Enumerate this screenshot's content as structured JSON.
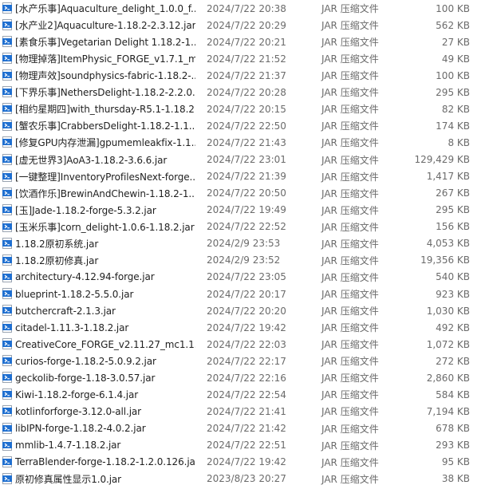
{
  "colors": {
    "icon_blue": "#1f6fd0",
    "text_primary": "#1f1f1f",
    "text_secondary": "#6b6b6b"
  },
  "files": [
    {
      "name": "[水产乐事]Aquaculture_delight_1.0.0_f...",
      "date": "2024/7/22 20:38",
      "type": "JAR 压缩文件",
      "size": "100 KB",
      "icon": "jar-file-icon"
    },
    {
      "name": "[水产业2]Aquaculture-1.18.2-2.3.12.jar",
      "date": "2024/7/22 20:29",
      "type": "JAR 压缩文件",
      "size": "562 KB",
      "icon": "jar-file-icon"
    },
    {
      "name": "[素食乐事]Vegetarian Delight 1.18.2-1...",
      "date": "2024/7/22 20:21",
      "type": "JAR 压缩文件",
      "size": "27 KB",
      "icon": "jar-file-icon"
    },
    {
      "name": "[物理掉落]ItemPhysic_FORGE_v1.7.1_m...",
      "date": "2024/7/22 21:52",
      "type": "JAR 压缩文件",
      "size": "49 KB",
      "icon": "jar-file-icon"
    },
    {
      "name": "[物理声效]soundphysics-fabric-1.18.2-...",
      "date": "2024/7/22 21:37",
      "type": "JAR 压缩文件",
      "size": "100 KB",
      "icon": "jar-file-icon"
    },
    {
      "name": "[下界乐事]NethersDelight-1.18.2-2.2.0....",
      "date": "2024/7/22 20:28",
      "type": "JAR 压缩文件",
      "size": "295 KB",
      "icon": "jar-file-icon"
    },
    {
      "name": "[相约星期四]with_thursday-R5.1-1.18.2...",
      "date": "2024/7/22 20:15",
      "type": "JAR 压缩文件",
      "size": "82 KB",
      "icon": "jar-file-icon"
    },
    {
      "name": "[蟹农乐事]CrabbersDelight-1.18.2-1.1....",
      "date": "2024/7/22 22:50",
      "type": "JAR 压缩文件",
      "size": "174 KB",
      "icon": "jar-file-icon"
    },
    {
      "name": "[修复GPU内存泄漏]gpumemleakfix-1.1...",
      "date": "2024/7/22 21:43",
      "type": "JAR 压缩文件",
      "size": "8 KB",
      "icon": "jar-file-icon"
    },
    {
      "name": "[虚无世界3]AoA3-1.18.2-3.6.6.jar",
      "date": "2024/7/22 23:01",
      "type": "JAR 压缩文件",
      "size": "129,429 KB",
      "icon": "jar-file-icon"
    },
    {
      "name": "[一键整理]InventoryProfilesNext-forge...",
      "date": "2024/7/22 21:39",
      "type": "JAR 压缩文件",
      "size": "1,417 KB",
      "icon": "jar-file-icon"
    },
    {
      "name": "[饮酒作乐]BrewinAndChewin-1.18.2-1....",
      "date": "2024/7/22 20:50",
      "type": "JAR 压缩文件",
      "size": "267 KB",
      "icon": "jar-file-icon"
    },
    {
      "name": "[玉]Jade-1.18.2-forge-5.3.2.jar",
      "date": "2024/7/22 19:49",
      "type": "JAR 压缩文件",
      "size": "295 KB",
      "icon": "jar-file-icon"
    },
    {
      "name": "[玉米乐事]corn_delight-1.0.6-1.18.2.jar",
      "date": "2024/7/22 22:52",
      "type": "JAR 压缩文件",
      "size": "156 KB",
      "icon": "jar-file-icon"
    },
    {
      "name": "1.18.2原初系统.jar",
      "date": "2024/2/9 23:53",
      "type": "JAR 压缩文件",
      "size": "4,053 KB",
      "icon": "jar-file-icon"
    },
    {
      "name": "1.18.2原初修真.jar",
      "date": "2024/2/9 23:52",
      "type": "JAR 压缩文件",
      "size": "19,356 KB",
      "icon": "jar-file-icon"
    },
    {
      "name": "architectury-4.12.94-forge.jar",
      "date": "2024/7/22 23:05",
      "type": "JAR 压缩文件",
      "size": "540 KB",
      "icon": "jar-file-icon"
    },
    {
      "name": "blueprint-1.18.2-5.5.0.jar",
      "date": "2024/7/22 20:17",
      "type": "JAR 压缩文件",
      "size": "923 KB",
      "icon": "jar-file-icon"
    },
    {
      "name": "butchercraft-2.1.3.jar",
      "date": "2024/7/22 20:20",
      "type": "JAR 压缩文件",
      "size": "1,030 KB",
      "icon": "jar-file-icon"
    },
    {
      "name": "citadel-1.11.3-1.18.2.jar",
      "date": "2024/7/22 19:42",
      "type": "JAR 压缩文件",
      "size": "492 KB",
      "icon": "jar-file-icon"
    },
    {
      "name": "CreativeCore_FORGE_v2.11.27_mc1.1...",
      "date": "2024/7/22 22:03",
      "type": "JAR 压缩文件",
      "size": "1,072 KB",
      "icon": "jar-file-icon"
    },
    {
      "name": "curios-forge-1.18.2-5.0.9.2.jar",
      "date": "2024/7/22 22:17",
      "type": "JAR 压缩文件",
      "size": "272 KB",
      "icon": "jar-file-icon"
    },
    {
      "name": "geckolib-forge-1.18-3.0.57.jar",
      "date": "2024/7/22 22:16",
      "type": "JAR 压缩文件",
      "size": "2,860 KB",
      "icon": "jar-file-icon"
    },
    {
      "name": "Kiwi-1.18.2-forge-6.1.4.jar",
      "date": "2024/7/22 22:54",
      "type": "JAR 压缩文件",
      "size": "584 KB",
      "icon": "jar-file-icon"
    },
    {
      "name": "kotlinforforge-3.12.0-all.jar",
      "date": "2024/7/22 21:41",
      "type": "JAR 压缩文件",
      "size": "7,194 KB",
      "icon": "jar-file-icon"
    },
    {
      "name": "libIPN-forge-1.18.2-4.0.2.jar",
      "date": "2024/7/22 21:42",
      "type": "JAR 压缩文件",
      "size": "678 KB",
      "icon": "jar-file-icon"
    },
    {
      "name": "mmlib-1.4.7-1.18.2.jar",
      "date": "2024/7/22 22:51",
      "type": "JAR 压缩文件",
      "size": "293 KB",
      "icon": "jar-file-icon"
    },
    {
      "name": "TerraBlender-forge-1.18.2-1.2.0.126.jar",
      "date": "2024/7/22 19:42",
      "type": "JAR 压缩文件",
      "size": "95 KB",
      "icon": "jar-file-icon"
    },
    {
      "name": "原初修真属性显示1.0.jar",
      "date": "2023/8/23 20:27",
      "type": "JAR 压缩文件",
      "size": "38 KB",
      "icon": "jar-file-icon"
    }
  ]
}
